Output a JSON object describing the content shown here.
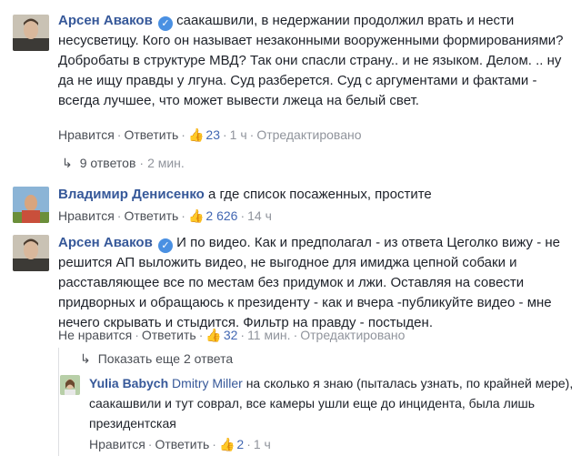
{
  "comments": [
    {
      "author": "Арсен Аваков",
      "text": "саакашвили, в недержании продолжил врать и нести несусветицу. Кого он называет незаконными вооруженными формированиями? Добробаты в структуре МВД? Так они спасли страну.. и не языком. Делом. .. ну да не ищу правды у лгуна. Суд разберется. Суд с аргументами и фактами - всегда лучшее, что может вывести лжеца на белый свет.",
      "like_action": "Нравится",
      "reply_action": "Ответить",
      "likes": "23",
      "time": "1 ч",
      "edited": "Отредактировано",
      "replies_text": "9 ответов",
      "replies_time": "2 мин."
    },
    {
      "author": "Владимир Денисенко",
      "text": "а где список посаженных, простите",
      "like_action": "Нравится",
      "reply_action": "Ответить",
      "likes": "2 626",
      "time": "14 ч"
    },
    {
      "author": "Арсен Аваков",
      "text": "И по видео. Как и предполагал - из ответа Цеголко вижу - не решится АП выложить видео, не выгодное для имиджа цепной собаки и расставляющее все по местам без придумок и лжи. Оставляя на совести придворных и обращаюсь к президенту - как и вчера -публикуйте видео - мне нечего скрывать и стыдится. Фильтр на правду - постыден.",
      "like_action": "Не нравится",
      "reply_action": "Ответить",
      "likes": "32",
      "time": "11 мин.",
      "edited": "Отредактировано",
      "more_replies": "Показать еще 2 ответа"
    }
  ],
  "nested_reply": {
    "author": "Yulia Babych",
    "mention": "Dmitry Miller",
    "text": "на сколько я знаю (пыталась узнать, по крайней мере), саакашвили и тут соврал, все камеры ушли еще до инцидента, была лишь президентская",
    "like_action": "Нравится",
    "reply_action": "Ответить",
    "likes": "2",
    "time": "1 ч"
  },
  "icons": {
    "verified": "verified-check-icon",
    "like": "thumbs-up-icon",
    "reply_arrow": "reply-arrow-icon"
  },
  "colors": {
    "author": "#365899",
    "like_count": "#4267b2",
    "meta": "#90949c"
  }
}
